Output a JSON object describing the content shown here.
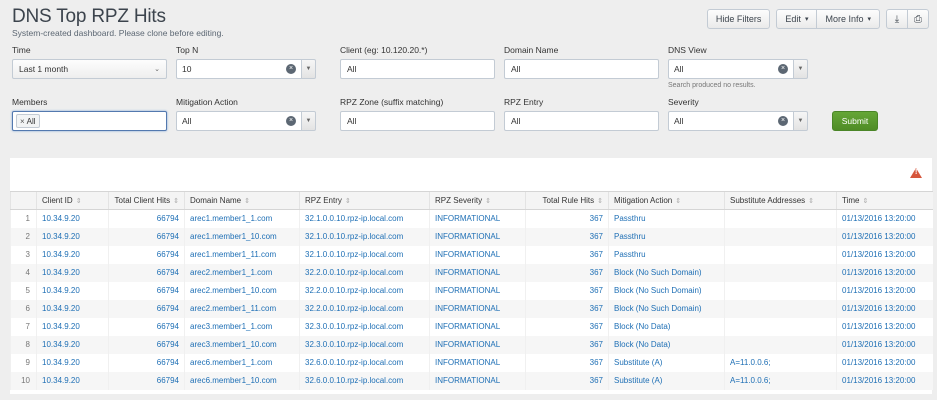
{
  "header": {
    "title": "DNS Top RPZ Hits",
    "description": "System-created dashboard. Please clone before editing.",
    "hide_filters_label": "Hide Filters",
    "edit_label": "Edit",
    "more_info_label": "More Info",
    "export_icon_glyph": "⤓",
    "print_icon_glyph": "⎙"
  },
  "filters": {
    "time": {
      "label": "Time",
      "value": "Last 1 month"
    },
    "topn": {
      "label": "Top N",
      "value": "10"
    },
    "client": {
      "label": "Client (eg: 10.120.20.*)",
      "value": "All"
    },
    "domain": {
      "label": "Domain Name",
      "value": "All"
    },
    "dnsview": {
      "label": "DNS View",
      "value": "All",
      "helper": "Search produced no results."
    },
    "members": {
      "label": "Members",
      "token": "All"
    },
    "mitigation": {
      "label": "Mitigation Action",
      "value": "All"
    },
    "rpzzone": {
      "label": "RPZ Zone (suffix matching)",
      "value": "All"
    },
    "rpzentry": {
      "label": "RPZ Entry",
      "value": "All"
    },
    "severity": {
      "label": "Severity",
      "value": "All"
    },
    "submit_label": "Submit"
  },
  "table": {
    "columns": [
      "",
      "Client ID",
      "Total Client Hits",
      "Domain Name",
      "RPZ Entry",
      "RPZ Severity",
      "Total Rule Hits",
      "Mitigation Action",
      "Substitute Addresses",
      "Time"
    ],
    "rows": [
      [
        "1",
        "10.34.9.20",
        "66794",
        "arec1.member1_1.com",
        "32.1.0.0.10.rpz-ip.local.com",
        "INFORMATIONAL",
        "367",
        "Passthru",
        "",
        "01/13/2016 13:20:00"
      ],
      [
        "2",
        "10.34.9.20",
        "66794",
        "arec1.member1_10.com",
        "32.1.0.0.10.rpz-ip.local.com",
        "INFORMATIONAL",
        "367",
        "Passthru",
        "",
        "01/13/2016 13:20:00"
      ],
      [
        "3",
        "10.34.9.20",
        "66794",
        "arec1.member1_11.com",
        "32.1.0.0.10.rpz-ip.local.com",
        "INFORMATIONAL",
        "367",
        "Passthru",
        "",
        "01/13/2016 13:20:00"
      ],
      [
        "4",
        "10.34.9.20",
        "66794",
        "arec2.member1_1.com",
        "32.2.0.0.10.rpz-ip.local.com",
        "INFORMATIONAL",
        "367",
        "Block (No Such Domain)",
        "",
        "01/13/2016 13:20:00"
      ],
      [
        "5",
        "10.34.9.20",
        "66794",
        "arec2.member1_10.com",
        "32.2.0.0.10.rpz-ip.local.com",
        "INFORMATIONAL",
        "367",
        "Block (No Such Domain)",
        "",
        "01/13/2016 13:20:00"
      ],
      [
        "6",
        "10.34.9.20",
        "66794",
        "arec2.member1_11.com",
        "32.2.0.0.10.rpz-ip.local.com",
        "INFORMATIONAL",
        "367",
        "Block (No Such Domain)",
        "",
        "01/13/2016 13:20:00"
      ],
      [
        "7",
        "10.34.9.20",
        "66794",
        "arec3.member1_1.com",
        "32.3.0.0.10.rpz-ip.local.com",
        "INFORMATIONAL",
        "367",
        "Block (No Data)",
        "",
        "01/13/2016 13:20:00"
      ],
      [
        "8",
        "10.34.9.20",
        "66794",
        "arec3.member1_10.com",
        "32.3.0.0.10.rpz-ip.local.com",
        "INFORMATIONAL",
        "367",
        "Block (No Data)",
        "",
        "01/13/2016 13:20:00"
      ],
      [
        "9",
        "10.34.9.20",
        "66794",
        "arec6.member1_1.com",
        "32.6.0.0.10.rpz-ip.local.com",
        "INFORMATIONAL",
        "367",
        "Substitute (A)",
        "A=11.0.0.6;",
        "01/13/2016 13:20:00"
      ],
      [
        "10",
        "10.34.9.20",
        "66794",
        "arec6.member1_10.com",
        "32.6.0.0.10.rpz-ip.local.com",
        "INFORMATIONAL",
        "367",
        "Substitute (A)",
        "A=11.0.0.6;",
        "01/13/2016 13:20:00"
      ]
    ]
  }
}
